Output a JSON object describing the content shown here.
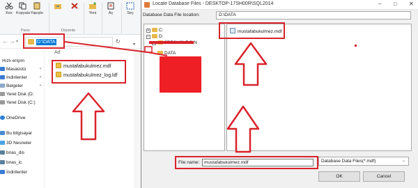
{
  "ribbon": {
    "buttons": [
      {
        "label": "Kes"
      },
      {
        "label": "Kopyala"
      },
      {
        "label": "Yapıştır"
      },
      {
        "label": ""
      },
      {
        "label": ""
      },
      {
        "label": "Yeni"
      },
      {
        "label": "Aç"
      },
      {
        "label": "Seç"
      }
    ],
    "groups": {
      "clipboard": "Pano",
      "organize": "Düzenle"
    }
  },
  "explorer": {
    "address": "D:\\DATA",
    "column_header": "Ad",
    "files": [
      "mustafabukulmez.mdf",
      "mustafabukulmez_log.ldf"
    ],
    "nav": [
      "Hızlı erişim",
      "Masaüstü",
      "İndirilenler",
      "Belgeler",
      "Yerel Disk (D:",
      "Yerel Disk (C:)",
      "OneDrive",
      "Bu bilgisayar",
      "3D Nesneler",
      "bnas_dis",
      "bnas_ic",
      "İndirilenler"
    ]
  },
  "dialog": {
    "title": "Locate Database Files - DESKTOP-17SH00R\\SQL2014",
    "location_label": "Database Data File location:",
    "location_value": "D:\\DATA",
    "tree": {
      "c_drive": "C:",
      "d_drive": "D:",
      "recycle": "$RECYCLE.BIN",
      "data": "DATA"
    },
    "files": [
      "mustafabukulmez.mdf"
    ],
    "file_name_label": "File name:",
    "file_name_value": "mustafabukulmez.mdf",
    "file_type": "Database Data Files(*.mdf)",
    "ok": "OK",
    "cancel": "Cancel"
  },
  "colors": {
    "annotation_red": "#d9222a",
    "selection_blue": "#0078d7",
    "folder_yellow": "#e7b84b"
  }
}
